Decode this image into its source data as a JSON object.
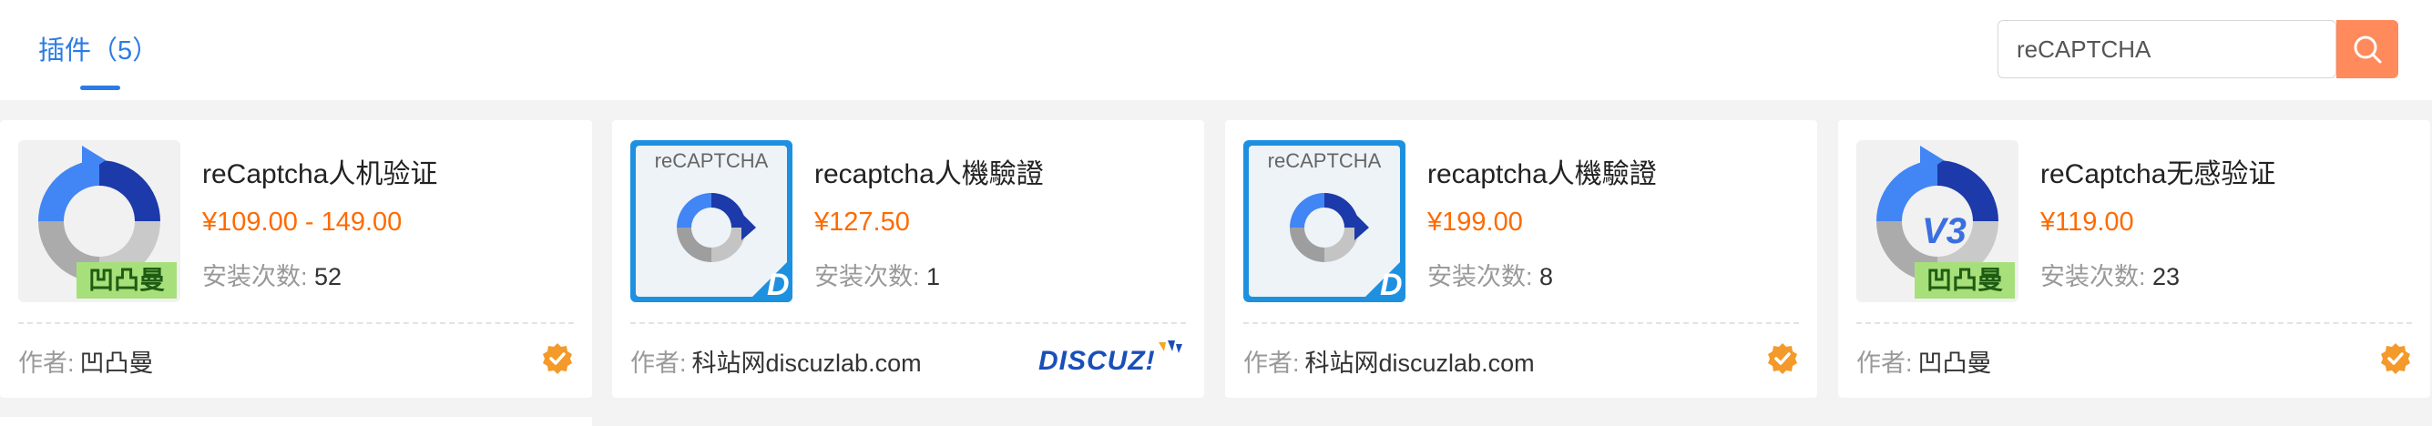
{
  "tabs": [
    {
      "label": "插件（5）",
      "active": true
    }
  ],
  "search": {
    "value": "reCAPTCHA",
    "button_icon": "search-icon"
  },
  "accent_color": "#2c7be5",
  "price_color": "#ff6a00",
  "search_button_color": "#ff8a5c",
  "plugins": [
    {
      "name": "reCaptcha人机验证",
      "price": "¥109.00 - 149.00",
      "installs_label": "安装次数:",
      "installs": "52",
      "author_label": "作者:",
      "author": "凹凸曼",
      "thumb_badge": "凹凸曼",
      "badge": "verified-icon"
    },
    {
      "name": "recaptcha人機驗證",
      "price": "¥127.50",
      "installs_label": "安装次数:",
      "installs": "1",
      "author_label": "作者:",
      "author": "科站网discuzlab.com",
      "thumb_text": "reCAPTCHA",
      "badge": "discuz-logo",
      "logo_text": "DISCUZ!"
    },
    {
      "name": "recaptcha人機驗證",
      "price": "¥199.00",
      "installs_label": "安装次数:",
      "installs": "8",
      "author_label": "作者:",
      "author": "科站网discuzlab.com",
      "thumb_text": "reCAPTCHA",
      "badge": "verified-icon"
    },
    {
      "name": "reCaptcha无感验证",
      "price": "¥119.00",
      "installs_label": "安装次数:",
      "installs": "23",
      "author_label": "作者:",
      "author": "凹凸曼",
      "thumb_badge": "凹凸曼",
      "thumb_text": "V3",
      "badge": "verified-icon"
    }
  ]
}
